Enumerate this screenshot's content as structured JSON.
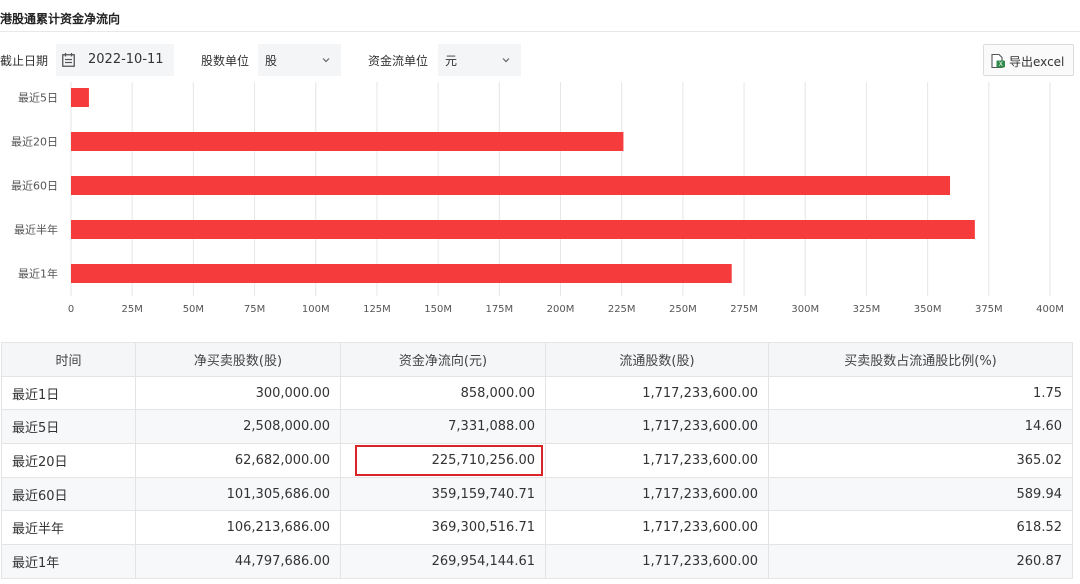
{
  "page": {
    "title": "港股通累计资金净流向"
  },
  "toolbar": {
    "date_label": "截止日期",
    "date_value": "2022-10-11",
    "share_unit_label": "股数单位",
    "share_unit_value": "股",
    "fund_unit_label": "资金流单位",
    "fund_unit_value": "元",
    "export_label": "导出excel"
  },
  "icons": {
    "date": "calendar-icon",
    "select": "chevron-down-icon",
    "export": "excel-export-icon"
  },
  "colors": {
    "bar": "#f53b3b",
    "highlight_border": "#d9252a",
    "header_bg": "#f5f6f8"
  },
  "chart_data": {
    "type": "bar",
    "orientation": "horizontal",
    "categories": [
      "最近5日",
      "最近20日",
      "最近60日",
      "最近半年",
      "最近1年"
    ],
    "values": [
      7331088,
      225710256,
      359159740.71,
      369300516.71,
      269954144.61
    ],
    "xlim": [
      0,
      400000000
    ],
    "xticks": [
      0,
      25000000,
      50000000,
      75000000,
      100000000,
      125000000,
      150000000,
      175000000,
      200000000,
      225000000,
      250000000,
      275000000,
      300000000,
      325000000,
      350000000,
      375000000,
      400000000
    ],
    "xtick_labels": [
      "0",
      "25M",
      "50M",
      "75M",
      "100M",
      "125M",
      "150M",
      "175M",
      "200M",
      "225M",
      "250M",
      "275M",
      "300M",
      "325M",
      "350M",
      "375M",
      "400M"
    ],
    "grid": true,
    "title": "",
    "xlabel": "",
    "ylabel": ""
  },
  "table": {
    "headers": [
      "时间",
      "净买卖股数(股)",
      "资金净流向(元)",
      "流通股数(股)",
      "买卖股数占流通股比例(%)"
    ],
    "rows": [
      [
        "最近1日",
        "300,000.00",
        "858,000.00",
        "1,717,233,600.00",
        "1.75"
      ],
      [
        "最近5日",
        "2,508,000.00",
        "7,331,088.00",
        "1,717,233,600.00",
        "14.60"
      ],
      [
        "最近20日",
        "62,682,000.00",
        "225,710,256.00",
        "1,717,233,600.00",
        "365.02"
      ],
      [
        "最近60日",
        "101,305,686.00",
        "359,159,740.71",
        "1,717,233,600.00",
        "589.94"
      ],
      [
        "最近半年",
        "106,213,686.00",
        "369,300,516.71",
        "1,717,233,600.00",
        "618.52"
      ],
      [
        "最近1年",
        "44,797,686.00",
        "269,954,144.61",
        "1,717,233,600.00",
        "260.87"
      ]
    ],
    "highlighted_cell": {
      "row": 2,
      "col": 2
    }
  }
}
